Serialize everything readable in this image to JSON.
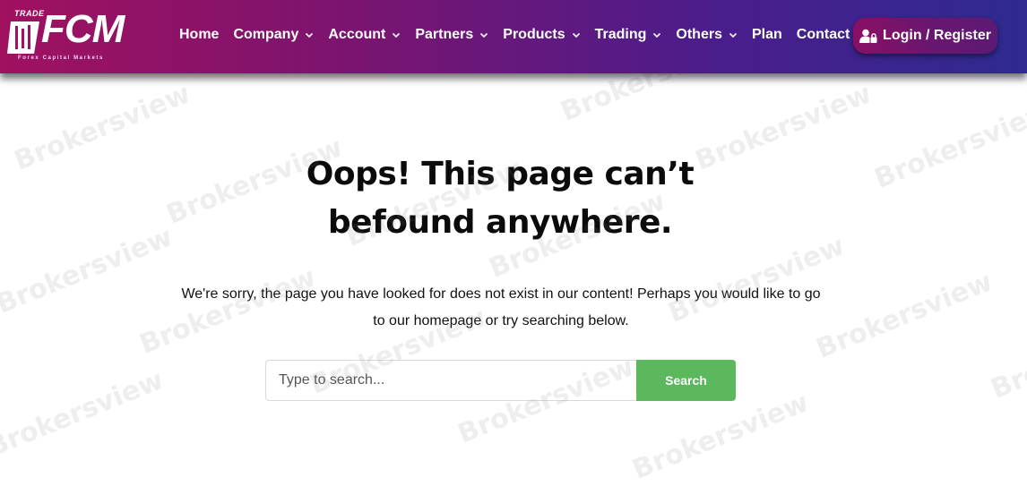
{
  "brand": {
    "logo_top": "TRADE",
    "logo_main": "FCM",
    "logo_sub": "Forex Capital Markets"
  },
  "nav": {
    "items": [
      {
        "label": "Home",
        "dropdown": false
      },
      {
        "label": "Company",
        "dropdown": true
      },
      {
        "label": "Account",
        "dropdown": true
      },
      {
        "label": "Partners",
        "dropdown": true
      },
      {
        "label": "Products",
        "dropdown": true
      },
      {
        "label": "Trading",
        "dropdown": true
      },
      {
        "label": "Others",
        "dropdown": true
      },
      {
        "label": "Plan",
        "dropdown": false
      },
      {
        "label": "Contact",
        "dropdown": false
      }
    ],
    "login_label": "Login / Register",
    "login_icon": "user-lock-icon"
  },
  "error": {
    "title": "Oops! This page can’t befound anywhere.",
    "message": "We're sorry, the page you have looked for does not exist in our content! Perhaps you would like to go to our homepage or try searching below."
  },
  "search": {
    "placeholder": "Type to search...",
    "value": "",
    "button_label": "Search"
  },
  "watermark": "Brokersview",
  "colors": {
    "header_start": "#a0115f",
    "header_end": "#2e2a8f",
    "search_button": "#5cb85c"
  }
}
